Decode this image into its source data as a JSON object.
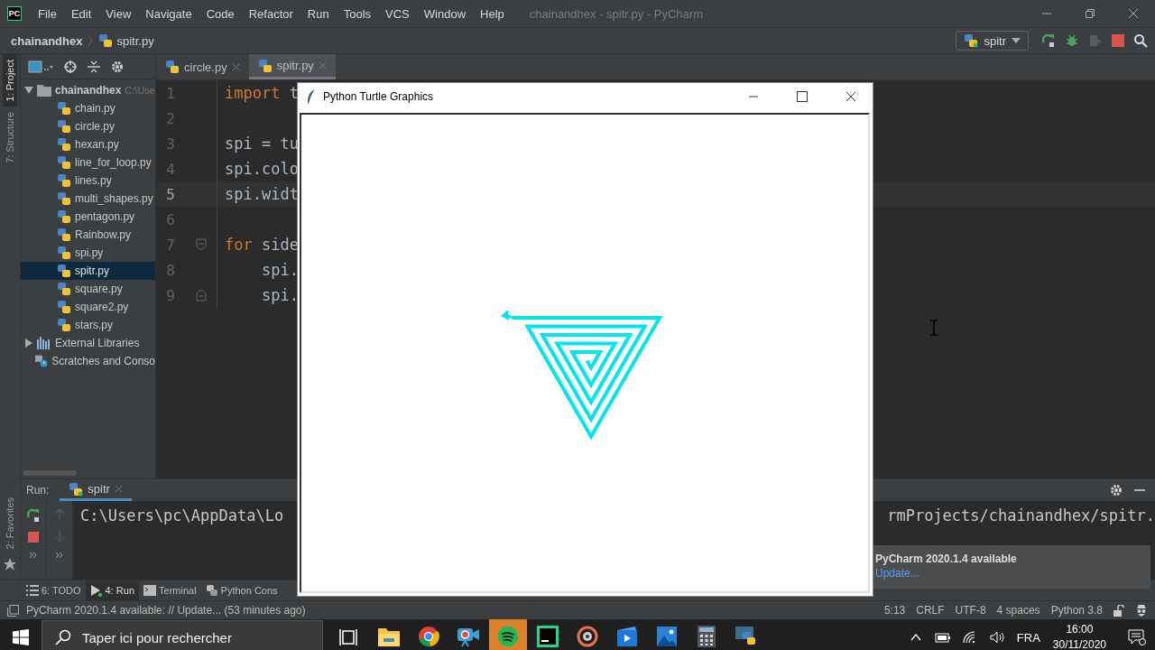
{
  "title_bar": {
    "logo": "PC",
    "menu": [
      "File",
      "Edit",
      "View",
      "Navigate",
      "Code",
      "Refactor",
      "Run",
      "Tools",
      "VCS",
      "Window",
      "Help"
    ],
    "title": "chainandhex - spitr.py - PyCharm"
  },
  "navigation_bar": {
    "breadcrumbs": [
      "chainandhex",
      "spitr.py"
    ],
    "run_config": "spitr"
  },
  "left_stripe": [
    {
      "label": "1: Project",
      "selected": true
    },
    {
      "label": "7: Structure",
      "selected": false
    }
  ],
  "bottom_stripe": {
    "label": "2: Favorites"
  },
  "project_tree": {
    "label": "chainandhex",
    "path": "C:\\Use",
    "expanded": true,
    "children": [
      {
        "label": "chain.py",
        "selected": false
      },
      {
        "label": "circle.py",
        "selected": false
      },
      {
        "label": "hexan.py",
        "selected": false
      },
      {
        "label": "line_for_loop.py",
        "selected": false
      },
      {
        "label": "lines.py",
        "selected": false
      },
      {
        "label": "multi_shapes.py",
        "selected": false
      },
      {
        "label": "pentagon.py",
        "selected": false
      },
      {
        "label": "Rainbow.py",
        "selected": false
      },
      {
        "label": "spi.py",
        "selected": false
      },
      {
        "label": "spitr.py",
        "selected": true
      },
      {
        "label": "square.py",
        "selected": false
      },
      {
        "label": "square2.py",
        "selected": false
      },
      {
        "label": "stars.py",
        "selected": false
      }
    ],
    "others": [
      {
        "kind": "library",
        "label": "External Libraries",
        "expanded": false
      },
      {
        "kind": "scratches",
        "label": "Scratches and Conso"
      }
    ]
  },
  "editor_tabs": [
    {
      "label": "circle.py",
      "selected": false
    },
    {
      "label": "spitr.py",
      "selected": true
    }
  ],
  "code_lines": [
    {
      "number": "1",
      "kind": "plain",
      "keyword": "import",
      "text": " t",
      "current": false
    },
    {
      "number": "2",
      "kind": "plain",
      "current": false
    },
    {
      "number": "3",
      "kind": "plain",
      "text": "spi = tu",
      "current": false
    },
    {
      "number": "4",
      "kind": "plain",
      "text": "spi.colo",
      "current": false
    },
    {
      "number": "5",
      "kind": "plain",
      "text": "spi.widt",
      "current": true
    },
    {
      "number": "6",
      "kind": "plain",
      "current": false
    },
    {
      "number": "7",
      "kind": "fold_start",
      "keyword": "for",
      "text": " side",
      "current": false
    },
    {
      "number": "8",
      "kind": "plain",
      "text": "    spi.",
      "current": false
    },
    {
      "number": "9",
      "kind": "fold_end",
      "text": "    spi.",
      "current": false
    }
  ],
  "run_panel": {
    "label": "Run:",
    "tab": "spitr",
    "output": [
      "C:\\Users\\pc\\AppData\\Lo",
      "rmProjects/chainandhex/spitr."
    ]
  },
  "tool_tabs": [
    {
      "label": "6: TODO",
      "kind": "list",
      "selected": false
    },
    {
      "label": "4: Run",
      "kind": "run",
      "selected": true
    },
    {
      "label": "Terminal",
      "kind": "terminal",
      "selected": false
    },
    {
      "label": "Python Cons",
      "kind": "python",
      "selected": false
    }
  ],
  "status_bar": {
    "message": "PyCharm 2020.1.4 available: // Update... (53 minutes ago)",
    "items": [
      "5:13",
      "CRLF",
      "UTF-8",
      "4 spaces",
      "Python 3.8"
    ]
  },
  "notification": {
    "title": "PyCharm 2020.1.4 available",
    "link": "Update..."
  },
  "turtle_window": {
    "title": "Python Turtle Graphics"
  },
  "taskbar": {
    "search_placeholder": "Taper ici pour rechercher",
    "apps": [
      {
        "kind": "taskview",
        "running": false,
        "selected": false
      },
      {
        "kind": "explorer",
        "running": true,
        "selected": false
      },
      {
        "kind": "chrome",
        "running": true,
        "selected": false
      },
      {
        "kind": "camera",
        "running": true,
        "selected": false
      },
      {
        "kind": "spotify",
        "running": true,
        "selected": true
      },
      {
        "kind": "pycharm",
        "running": true,
        "selected": false
      },
      {
        "kind": "media",
        "running": true,
        "selected": false
      },
      {
        "kind": "video",
        "running": true,
        "selected": false
      },
      {
        "kind": "photos",
        "running": true,
        "selected": false
      },
      {
        "kind": "calculator",
        "running": true,
        "selected": false
      },
      {
        "kind": "python",
        "running": true,
        "selected": false
      }
    ],
    "language": "FRA",
    "time": "16:00",
    "date": "30/11/2020"
  }
}
